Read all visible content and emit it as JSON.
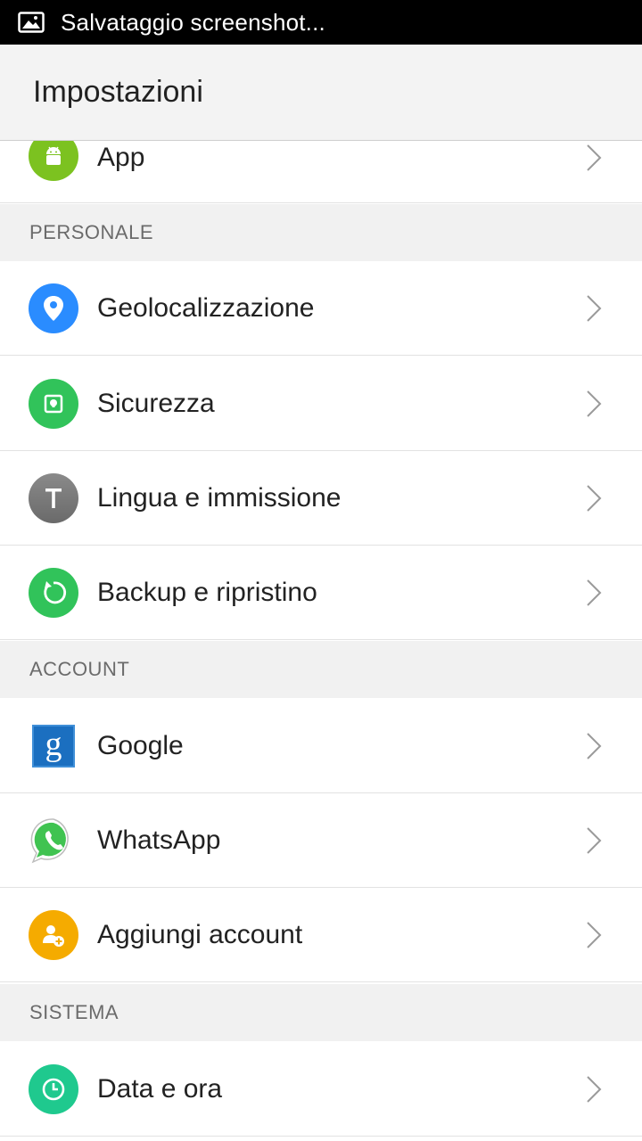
{
  "status_bar": {
    "icon": "image-icon",
    "text": "Salvataggio screenshot..."
  },
  "action_bar": {
    "title": "Impostazioni"
  },
  "items": {
    "app": {
      "label": "App",
      "icon": "android-icon",
      "color": "#7cc220"
    },
    "geolocalizzazione": {
      "label": "Geolocalizzazione",
      "icon": "location-pin-icon",
      "color": "#2a8cff"
    },
    "sicurezza": {
      "label": "Sicurezza",
      "icon": "lock-icon",
      "color": "#31c35a"
    },
    "lingua": {
      "label": "Lingua e immissione",
      "icon": "text-t-icon",
      "color": "#7d7d7d"
    },
    "backup": {
      "label": "Backup e ripristino",
      "icon": "restore-icon",
      "color": "#31c35a"
    },
    "google": {
      "label": "Google",
      "icon": "google-icon",
      "color": "#1b6fc0"
    },
    "whatsapp": {
      "label": "WhatsApp",
      "icon": "whatsapp-icon",
      "color": "#40c351"
    },
    "aggiungi": {
      "label": "Aggiungi account",
      "icon": "add-account-icon",
      "color": "#f5ab00"
    },
    "data": {
      "label": "Data e ora",
      "icon": "clock-icon",
      "color": "#1fc98e"
    }
  },
  "sections": {
    "personale": "PERSONALE",
    "account": "ACCOUNT",
    "sistema": "SISTEMA"
  }
}
